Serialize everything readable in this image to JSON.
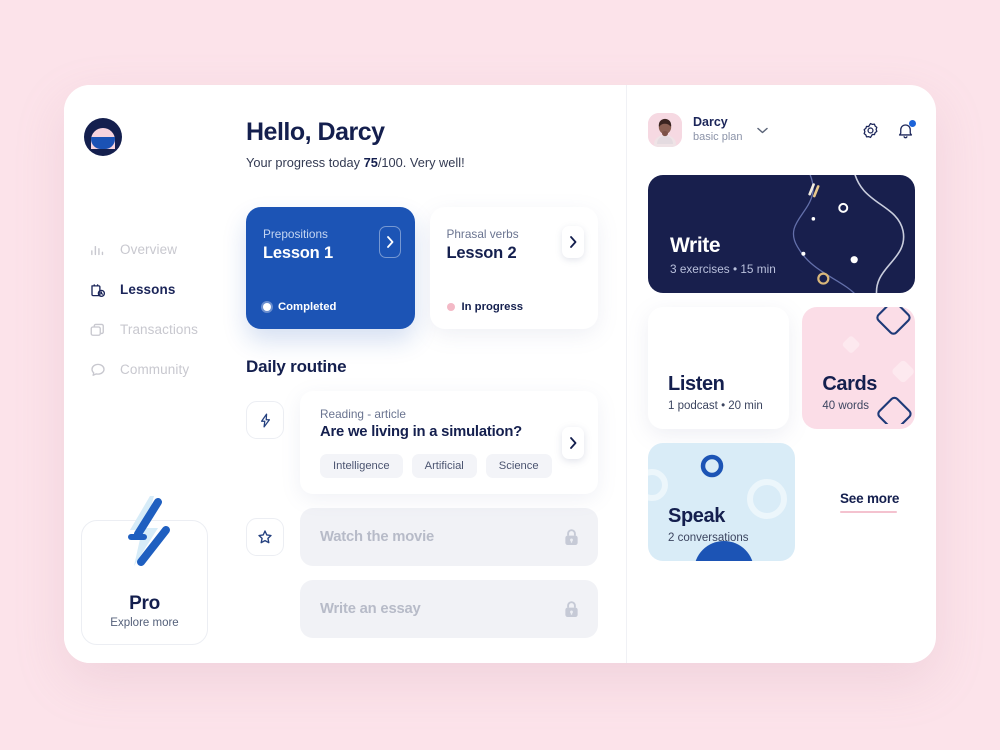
{
  "app": {
    "logo_icon": "app-logo-circle"
  },
  "sidebar": {
    "items": [
      {
        "label": "Overview",
        "icon": "bar-chart-icon",
        "active": false
      },
      {
        "label": "Lessons",
        "icon": "lesson-bag-clock-icon",
        "active": true
      },
      {
        "label": "Transactions",
        "icon": "cards-stack-icon",
        "active": false
      },
      {
        "label": "Community",
        "icon": "chat-bubble-icon",
        "active": false
      }
    ],
    "pro": {
      "icon": "lightning-bolt-icon",
      "title": "Pro",
      "subtitle": "Explore more"
    }
  },
  "header": {
    "greeting": "Hello, Darcy",
    "progress_prefix": "Your progress today ",
    "progress_value": "75",
    "progress_suffix": "/100. Very well!"
  },
  "lessons": [
    {
      "topic": "Prepositions",
      "name": "Lesson 1",
      "status": "Completed",
      "status_type": "done",
      "chevron_icon": "chevron-right-icon"
    },
    {
      "topic": "Phrasal verbs",
      "name": "Lesson 2",
      "status": "In progress",
      "status_type": "in-progress",
      "chevron_icon": "chevron-right-icon"
    }
  ],
  "routine": {
    "title": "Daily routine",
    "article": {
      "badge_icon": "lightning-bolt-icon",
      "kicker": "Reading - article",
      "heading": "Are we living in a simulation?",
      "tags": [
        "Intelligence",
        "Artificial",
        "Science"
      ],
      "chevron_icon": "chevron-right-icon"
    },
    "locked": [
      {
        "badge_icon": "star-icon",
        "label": "Watch the movie",
        "lock_icon": "lock-icon"
      },
      {
        "badge_icon": "none",
        "label": "Write an essay",
        "lock_icon": "lock-icon"
      }
    ]
  },
  "profile": {
    "avatar_icon": "user-avatar",
    "name": "Darcy",
    "plan": "basic plan",
    "chevron_icon": "chevron-down-icon",
    "settings_icon": "gear-icon",
    "notifications_icon": "bell-icon",
    "has_notification": true
  },
  "activities": {
    "write": {
      "title": "Write",
      "meta": "3 exercises  •  15 min",
      "color": "#181f4d"
    },
    "listen": {
      "title": "Listen",
      "meta": "1 podcast  •  20 min",
      "color": "#ffffff"
    },
    "cards": {
      "title": "Cards",
      "meta": "40 words",
      "color": "#fbdde7"
    },
    "speak": {
      "title": "Speak",
      "meta": "2 conversations",
      "color": "#d9ecf7"
    },
    "see_more": "See more"
  },
  "colors": {
    "page_background": "#fce3ea",
    "accent_blue": "#1c54b5",
    "navy": "#141f4e",
    "pink": "#fbdde7",
    "light_blue": "#d9ecf7"
  }
}
